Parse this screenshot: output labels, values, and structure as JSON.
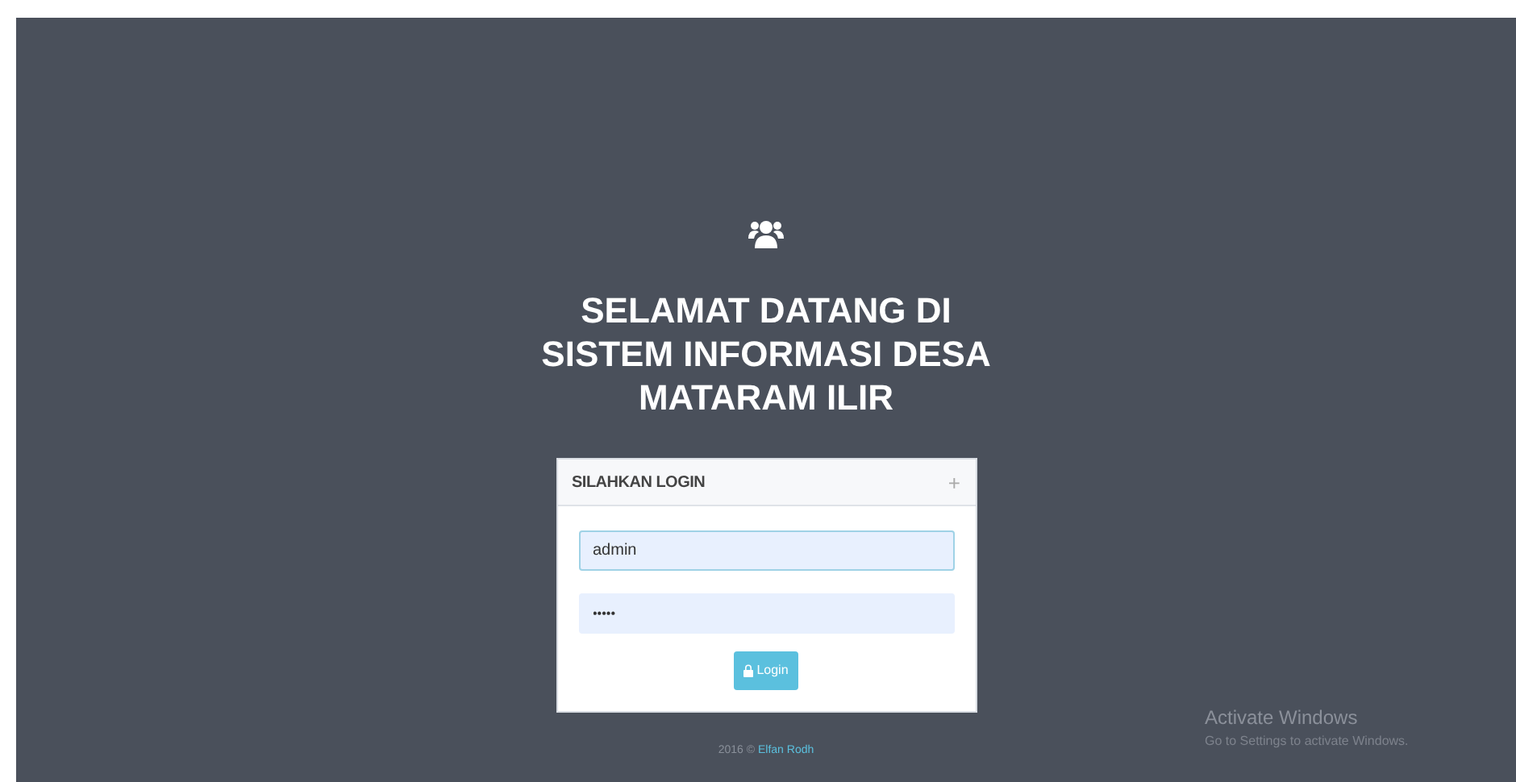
{
  "heading": [
    "SELAMAT DATANG DI",
    "SISTEM INFORMASI DESA",
    "MATARAM ILIR"
  ],
  "login_panel": {
    "title": "SILAHKAN LOGIN",
    "expand_symbol": "+",
    "username": {
      "value": "admin"
    },
    "password": {
      "value": "•••••"
    },
    "button": "Login"
  },
  "footer": {
    "text": "2016 ©",
    "link": "Elfan Rodh"
  },
  "activation_notice": {
    "title": "Activate Windows",
    "text": "Go to Settings to activate Windows."
  }
}
